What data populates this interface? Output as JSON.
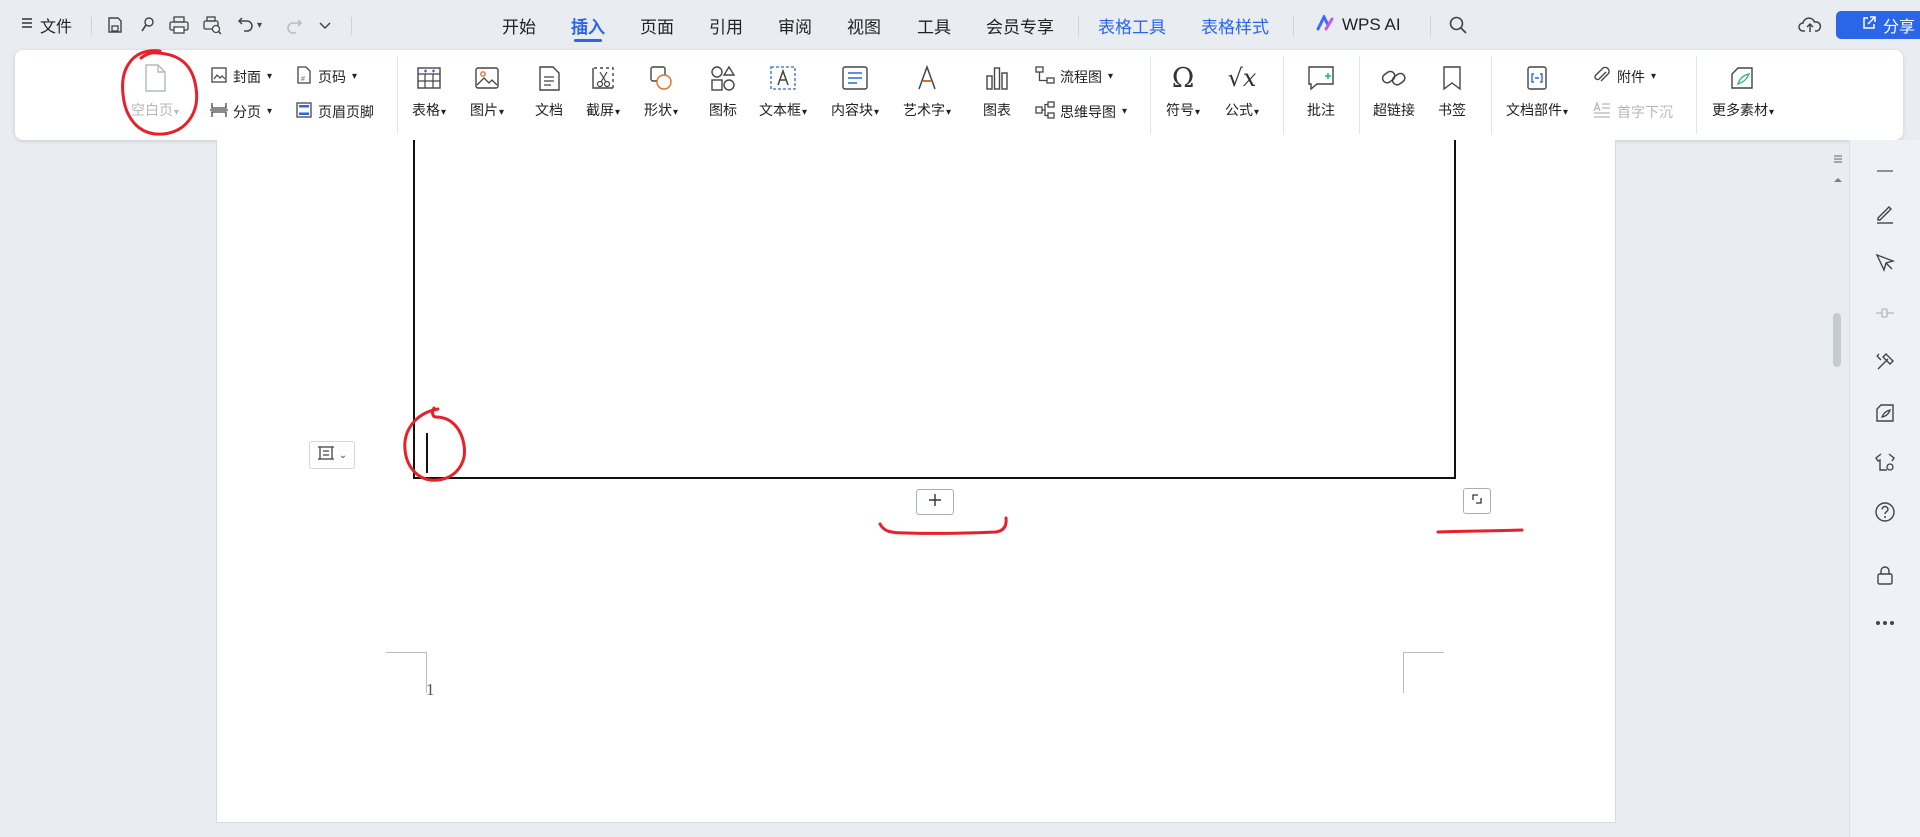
{
  "titlebar": {
    "file_label": "文件",
    "menu_tabs": [
      {
        "label": "开始"
      },
      {
        "label": "插入"
      },
      {
        "label": "页面"
      },
      {
        "label": "引用"
      },
      {
        "label": "审阅"
      },
      {
        "label": "视图"
      },
      {
        "label": "工具"
      },
      {
        "label": "会员专享"
      },
      {
        "label": "表格工具"
      },
      {
        "label": "表格样式"
      }
    ],
    "active_tab": "插入",
    "wps_ai_label": "WPS AI",
    "share_label": "分享"
  },
  "ribbon": {
    "blank_page": "空白页",
    "cover": "封面",
    "page_break": "分页",
    "page_number": "页码",
    "header_footer": "页眉页脚",
    "table": "表格",
    "picture": "图片",
    "document": "文档",
    "screenshot": "截屏",
    "shape": "形状",
    "icon": "图标",
    "textbox": "文本框",
    "content_block": "内容块",
    "wordart": "艺术字",
    "chart": "图表",
    "flowchart": "流程图",
    "mindmap": "思维导图",
    "symbol": "符号",
    "formula": "公式",
    "comment": "批注",
    "hyperlink": "超链接",
    "bookmark": "书签",
    "doc_parts": "文档部件",
    "attachment": "附件",
    "drop_cap": "首字下沉",
    "more_materials": "更多素材"
  },
  "document": {
    "page_number": "1"
  },
  "colors": {
    "accent": "#2b66e8",
    "annotation": "#e8202a",
    "background": "#e9edf2",
    "disabled": "#b4b8be"
  }
}
